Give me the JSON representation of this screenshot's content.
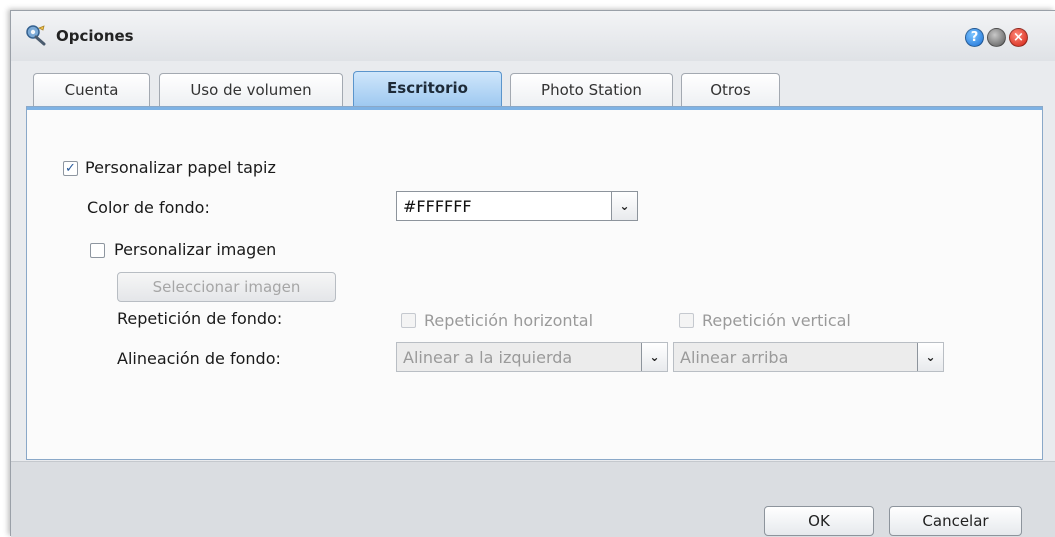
{
  "window": {
    "title": "Opciones",
    "title_icon": "wrench-gear-icon",
    "buttons": {
      "help": "?",
      "minimize": "",
      "close": "×"
    }
  },
  "tabs": [
    {
      "label": "Cuenta",
      "active": false
    },
    {
      "label": "Uso de volumen",
      "active": false
    },
    {
      "label": "Escritorio",
      "active": true
    },
    {
      "label": "Photo Station",
      "active": false
    },
    {
      "label": "Otros",
      "active": false
    }
  ],
  "desktop": {
    "customize_wallpaper": {
      "label": "Personalizar papel tapiz",
      "checked": true
    },
    "background_color": {
      "label": "Color de fondo:",
      "value": "#FFFFFF"
    },
    "customize_image": {
      "label": "Personalizar imagen",
      "checked": false
    },
    "select_image_button": "Seleccionar imagen",
    "background_repeat": {
      "label": "Repetición de fondo:",
      "horizontal": {
        "label": "Repetición horizontal",
        "checked": false,
        "enabled": false
      },
      "vertical": {
        "label": "Repetición vertical",
        "checked": false,
        "enabled": false
      }
    },
    "background_alignment": {
      "label": "Alineación de fondo:",
      "horizontal_value": "Alinear a la izquierda",
      "vertical_value": "Alinear arriba"
    }
  },
  "footer": {
    "ok_label": "OK",
    "cancel_label": "Cancelar"
  },
  "colors": {
    "accent": "#5b95cc",
    "active_tab": "#9dc8f0",
    "close_button": "#d11e10",
    "help_button": "#1a6fd6"
  }
}
